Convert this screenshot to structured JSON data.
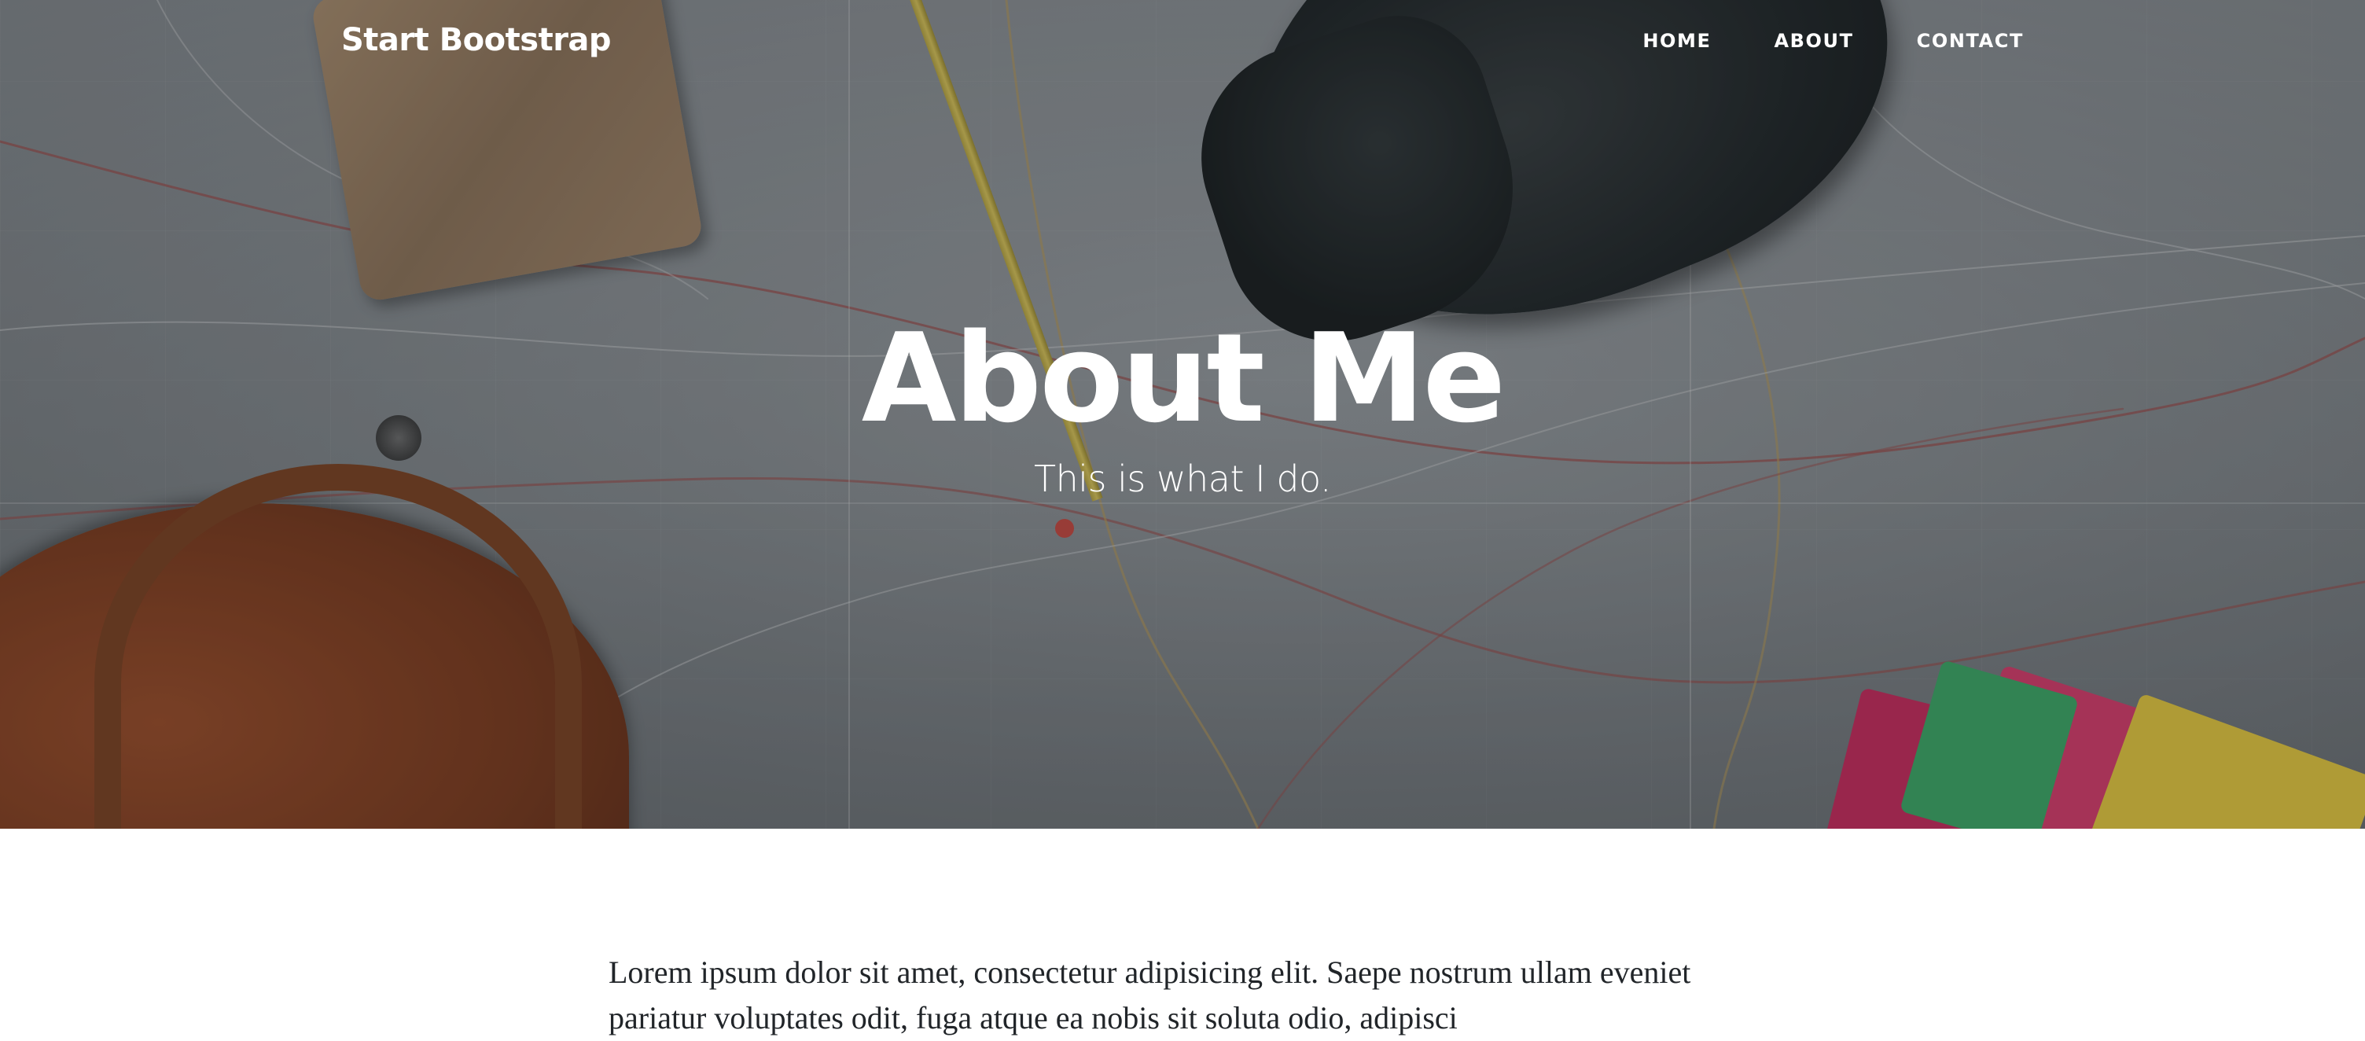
{
  "navbar": {
    "brand": "Start Bootstrap",
    "links": [
      {
        "label": "HOME"
      },
      {
        "label": "ABOUT"
      },
      {
        "label": "CONTACT"
      }
    ]
  },
  "header": {
    "title": "About Me",
    "subtitle": "This is what I do."
  },
  "content": {
    "paragraph": "Lorem ipsum dolor sit amet, consectetur adipisicing elit. Saepe nostrum ullam eveniet pariatur voluptates odit, fuga atque ea nobis sit soluta odio, adipisci"
  },
  "colors": {
    "text_on_hero": "#ffffff",
    "body_text": "#212529",
    "hero_overlay": "#212529"
  },
  "icons": {
    "background": "map-photo-background"
  }
}
